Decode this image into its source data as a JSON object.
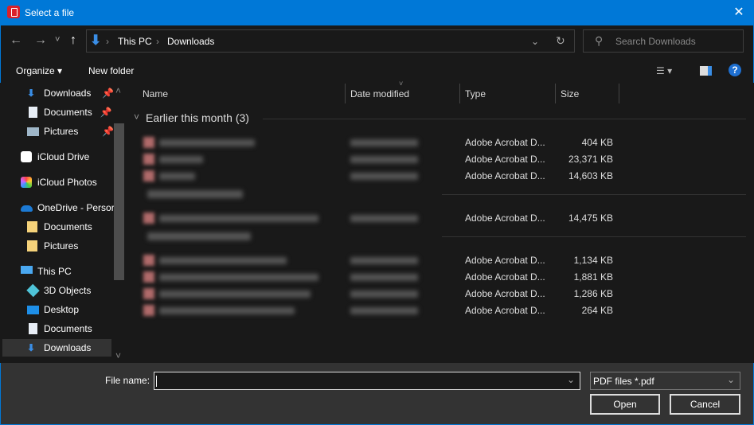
{
  "window": {
    "title": "Select a file",
    "close": "✕"
  },
  "nav": {
    "back": "←",
    "forward": "→",
    "recent": "˅",
    "up": "↑",
    "breadcrumb": [
      "This PC",
      "Downloads"
    ],
    "sep": "›",
    "search_placeholder": "Search Downloads"
  },
  "toolbar": {
    "organize": "Organize ▾",
    "new_folder": "New folder",
    "help": "?"
  },
  "sidebar": {
    "items": [
      {
        "label": "Downloads",
        "icon": "download-icon",
        "pinned": true
      },
      {
        "label": "Documents",
        "icon": "document-icon",
        "pinned": true
      },
      {
        "label": "Pictures",
        "icon": "picture-icon",
        "pinned": true
      },
      {
        "label": "iCloud Drive",
        "icon": "icloud-icon"
      },
      {
        "label": "iCloud Photos",
        "icon": "photos-icon"
      },
      {
        "label": "OneDrive - Persor",
        "icon": "onedrive-icon"
      },
      {
        "label": "Documents",
        "icon": "folder-icon"
      },
      {
        "label": "Pictures",
        "icon": "folder-icon"
      },
      {
        "label": "This PC",
        "icon": "computer-icon"
      },
      {
        "label": "3D Objects",
        "icon": "cube-icon"
      },
      {
        "label": "Desktop",
        "icon": "desktop-icon"
      },
      {
        "label": "Documents",
        "icon": "document-icon"
      },
      {
        "label": "Downloads",
        "icon": "download-icon",
        "selected": true
      }
    ]
  },
  "columns": [
    "Name",
    "Date modified",
    "Type",
    "Size"
  ],
  "groups": [
    {
      "label": "Earlier this month (3)"
    }
  ],
  "files": [
    {
      "type": "Adobe Acrobat D...",
      "size": "404 KB"
    },
    {
      "type": "Adobe Acrobat D...",
      "size": "23,371 KB"
    },
    {
      "type": "Adobe Acrobat D...",
      "size": "14,603 KB"
    },
    {
      "type": "Adobe Acrobat D...",
      "size": "14,475 KB"
    },
    {
      "type": "Adobe Acrobat D...",
      "size": "1,134 KB"
    },
    {
      "type": "Adobe Acrobat D...",
      "size": "1,881 KB"
    },
    {
      "type": "Adobe Acrobat D...",
      "size": "1,286 KB"
    },
    {
      "type": "Adobe Acrobat D...",
      "size": "264 KB"
    }
  ],
  "footer": {
    "filename_label": "File name:",
    "filename_value": "",
    "filter": "PDF files *.pdf",
    "open": "Open",
    "cancel": "Cancel"
  }
}
